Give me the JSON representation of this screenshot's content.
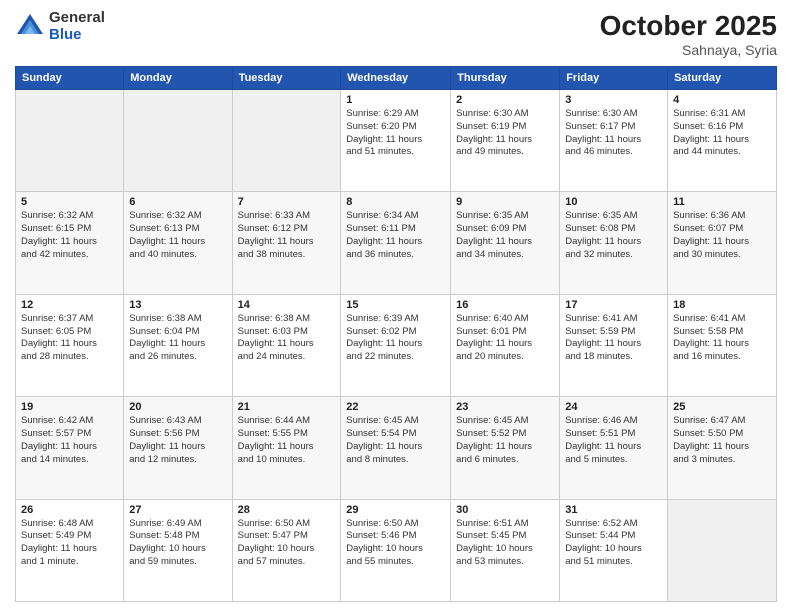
{
  "header": {
    "logo_general": "General",
    "logo_blue": "Blue",
    "month": "October 2025",
    "location": "Sahnaya, Syria"
  },
  "days_of_week": [
    "Sunday",
    "Monday",
    "Tuesday",
    "Wednesday",
    "Thursday",
    "Friday",
    "Saturday"
  ],
  "weeks": [
    [
      {
        "day": "",
        "detail": ""
      },
      {
        "day": "",
        "detail": ""
      },
      {
        "day": "",
        "detail": ""
      },
      {
        "day": "1",
        "detail": "Sunrise: 6:29 AM\nSunset: 6:20 PM\nDaylight: 11 hours\nand 51 minutes."
      },
      {
        "day": "2",
        "detail": "Sunrise: 6:30 AM\nSunset: 6:19 PM\nDaylight: 11 hours\nand 49 minutes."
      },
      {
        "day": "3",
        "detail": "Sunrise: 6:30 AM\nSunset: 6:17 PM\nDaylight: 11 hours\nand 46 minutes."
      },
      {
        "day": "4",
        "detail": "Sunrise: 6:31 AM\nSunset: 6:16 PM\nDaylight: 11 hours\nand 44 minutes."
      }
    ],
    [
      {
        "day": "5",
        "detail": "Sunrise: 6:32 AM\nSunset: 6:15 PM\nDaylight: 11 hours\nand 42 minutes."
      },
      {
        "day": "6",
        "detail": "Sunrise: 6:32 AM\nSunset: 6:13 PM\nDaylight: 11 hours\nand 40 minutes."
      },
      {
        "day": "7",
        "detail": "Sunrise: 6:33 AM\nSunset: 6:12 PM\nDaylight: 11 hours\nand 38 minutes."
      },
      {
        "day": "8",
        "detail": "Sunrise: 6:34 AM\nSunset: 6:11 PM\nDaylight: 11 hours\nand 36 minutes."
      },
      {
        "day": "9",
        "detail": "Sunrise: 6:35 AM\nSunset: 6:09 PM\nDaylight: 11 hours\nand 34 minutes."
      },
      {
        "day": "10",
        "detail": "Sunrise: 6:35 AM\nSunset: 6:08 PM\nDaylight: 11 hours\nand 32 minutes."
      },
      {
        "day": "11",
        "detail": "Sunrise: 6:36 AM\nSunset: 6:07 PM\nDaylight: 11 hours\nand 30 minutes."
      }
    ],
    [
      {
        "day": "12",
        "detail": "Sunrise: 6:37 AM\nSunset: 6:05 PM\nDaylight: 11 hours\nand 28 minutes."
      },
      {
        "day": "13",
        "detail": "Sunrise: 6:38 AM\nSunset: 6:04 PM\nDaylight: 11 hours\nand 26 minutes."
      },
      {
        "day": "14",
        "detail": "Sunrise: 6:38 AM\nSunset: 6:03 PM\nDaylight: 11 hours\nand 24 minutes."
      },
      {
        "day": "15",
        "detail": "Sunrise: 6:39 AM\nSunset: 6:02 PM\nDaylight: 11 hours\nand 22 minutes."
      },
      {
        "day": "16",
        "detail": "Sunrise: 6:40 AM\nSunset: 6:01 PM\nDaylight: 11 hours\nand 20 minutes."
      },
      {
        "day": "17",
        "detail": "Sunrise: 6:41 AM\nSunset: 5:59 PM\nDaylight: 11 hours\nand 18 minutes."
      },
      {
        "day": "18",
        "detail": "Sunrise: 6:41 AM\nSunset: 5:58 PM\nDaylight: 11 hours\nand 16 minutes."
      }
    ],
    [
      {
        "day": "19",
        "detail": "Sunrise: 6:42 AM\nSunset: 5:57 PM\nDaylight: 11 hours\nand 14 minutes."
      },
      {
        "day": "20",
        "detail": "Sunrise: 6:43 AM\nSunset: 5:56 PM\nDaylight: 11 hours\nand 12 minutes."
      },
      {
        "day": "21",
        "detail": "Sunrise: 6:44 AM\nSunset: 5:55 PM\nDaylight: 11 hours\nand 10 minutes."
      },
      {
        "day": "22",
        "detail": "Sunrise: 6:45 AM\nSunset: 5:54 PM\nDaylight: 11 hours\nand 8 minutes."
      },
      {
        "day": "23",
        "detail": "Sunrise: 6:45 AM\nSunset: 5:52 PM\nDaylight: 11 hours\nand 6 minutes."
      },
      {
        "day": "24",
        "detail": "Sunrise: 6:46 AM\nSunset: 5:51 PM\nDaylight: 11 hours\nand 5 minutes."
      },
      {
        "day": "25",
        "detail": "Sunrise: 6:47 AM\nSunset: 5:50 PM\nDaylight: 11 hours\nand 3 minutes."
      }
    ],
    [
      {
        "day": "26",
        "detail": "Sunrise: 6:48 AM\nSunset: 5:49 PM\nDaylight: 11 hours\nand 1 minute."
      },
      {
        "day": "27",
        "detail": "Sunrise: 6:49 AM\nSunset: 5:48 PM\nDaylight: 10 hours\nand 59 minutes."
      },
      {
        "day": "28",
        "detail": "Sunrise: 6:50 AM\nSunset: 5:47 PM\nDaylight: 10 hours\nand 57 minutes."
      },
      {
        "day": "29",
        "detail": "Sunrise: 6:50 AM\nSunset: 5:46 PM\nDaylight: 10 hours\nand 55 minutes."
      },
      {
        "day": "30",
        "detail": "Sunrise: 6:51 AM\nSunset: 5:45 PM\nDaylight: 10 hours\nand 53 minutes."
      },
      {
        "day": "31",
        "detail": "Sunrise: 6:52 AM\nSunset: 5:44 PM\nDaylight: 10 hours\nand 51 minutes."
      },
      {
        "day": "",
        "detail": ""
      }
    ]
  ]
}
